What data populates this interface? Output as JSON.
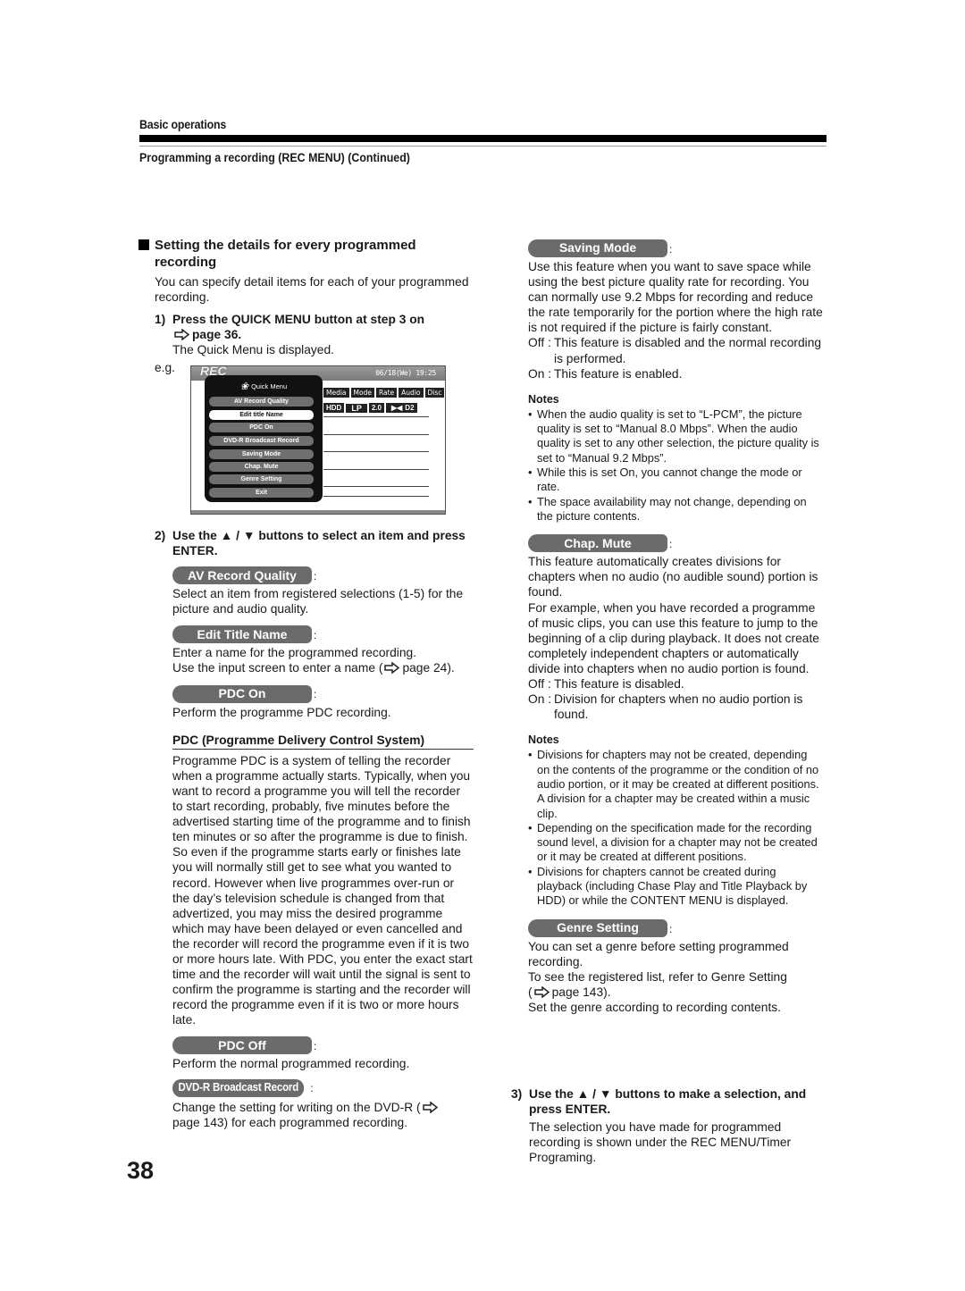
{
  "header": {
    "section": "Basic operations",
    "subsection": "Programming a recording (REC MENU) (Continued)"
  },
  "left": {
    "heading": "Setting the details for every programmed recording",
    "intro": "You can specify detail items for each of your programmed recording.",
    "step1": {
      "num": "1)",
      "text": "Press the QUICK MENU button at step 3 on",
      "ref": "page 36.",
      "result": "The Quick Menu is displayed."
    },
    "eg_label": "e.g.",
    "screen": {
      "rec_label": "REC",
      "datetime": "06/18(We) 19:25",
      "columns": [
        "Media",
        "Mode",
        "Rate",
        "Audio",
        "Disc"
      ],
      "values": [
        "HDD",
        "LP",
        "2.0",
        "D2"
      ],
      "quick_menu": {
        "title": "Quick Menu",
        "items": [
          "AV Record Quality",
          "Edit title Name",
          "PDC On",
          "DVD-R Broadcast Record",
          "Saving Mode",
          "Chap. Mute",
          "Genre Setting",
          "Exit"
        ],
        "selected_index": 1
      }
    },
    "step2": {
      "num": "2)",
      "text": "Use the ▲ / ▼ buttons to select an item and press ENTER."
    },
    "av_record_quality": {
      "label": "AV Record Quality",
      "desc": "Select an item from registered selections (1-5) for the picture and audio quality."
    },
    "edit_title_name": {
      "label": "Edit Title Name",
      "desc1": "Enter a name for the programmed recording.",
      "desc2_pre": "Use the input screen to enter a name (",
      "desc2_ref": "page 24)."
    },
    "pdc_on": {
      "label": "PDC On",
      "desc": "Perform the programme PDC recording."
    },
    "pdc_system": {
      "heading": "PDC (Programme Delivery Control System)",
      "body": "Programme PDC is a system of telling the recorder when a programme actually starts. Typically, when you want to record a programme you will tell the recorder to start recording, probably, five minutes before the advertised starting time of the programme and to finish ten minutes or so after the programme is due to finish. So even if the programme starts early or finishes late you will normally still get to see what you wanted to record. However when live programmes over-run or the day’s television schedule is changed from that advertized, you may miss the desired programme which may have been delayed or even cancelled and the recorder will record the programme even if it is two or more hours late. With PDC, you enter the exact start time and the recorder will wait until the signal is sent to confirm the programme is starting and the recorder will record the programme even if it is two or more hours late."
    },
    "pdc_off": {
      "label": "PDC Off",
      "desc": "Perform the normal programmed recording."
    },
    "dvdr_broadcast": {
      "label": "DVD-R Broadcast Record",
      "desc_pre": "Change the setting for writing on the DVD-R (",
      "desc_post": "page 143) for each programmed recording."
    }
  },
  "right": {
    "saving_mode": {
      "label": "Saving Mode",
      "desc": "Use this feature when you want to save space while using the best picture quality rate for recording. You can normally use 9.2 Mbps for recording and reduce the rate temporarily for the portion where the high rate is not required if the picture is fairly constant.",
      "off_key": "Off :",
      "off_val": "This feature is disabled and the normal recording is performed.",
      "on_key": "On :",
      "on_val": "This feature is enabled.",
      "notes_title": "Notes",
      "notes": [
        "When the audio quality is set to “L-PCM”, the picture quality is set to “Manual 8.0 Mbps”. When the audio quality is set to any other selection, the picture quality is set to “Manual 9.2 Mbps”.",
        "While this is set On, you cannot change the mode or rate.",
        "The space availability may not change, depending on the picture contents."
      ]
    },
    "chap_mute": {
      "label": "Chap. Mute",
      "desc1": "This feature automatically creates divisions for chapters when no audio (no audible sound) portion is found.",
      "desc2": "For example, when you have recorded a programme of music clips, you can use this feature to jump to the beginning of a clip during playback. It does not create completely independent chapters or automatically divide into chapters when no audio portion is found.",
      "off_key": "Off :",
      "off_val": "This feature is disabled.",
      "on_key": "On :",
      "on_val": "Division for chapters when no audio portion is found.",
      "notes_title": "Notes",
      "notes": [
        "Divisions for chapters may not be created, depending on the contents of the programme or the condition of no audio portion, or it may be created at different positions. A division for a chapter may be created within a music clip.",
        "Depending on the specification made for the recording sound level, a division for a chapter may not be created or it may be created at different positions.",
        "Divisions for chapters cannot be created during playback (including Chase Play and Title Playback by HDD) or while the CONTENT MENU is displayed."
      ]
    },
    "genre_setting": {
      "label": "Genre Setting",
      "desc1": "You can set a genre before setting programmed recording.",
      "desc2": "To see the registered list, refer to Genre Setting",
      "desc3_pre": "(",
      "desc3_ref": "page 143).",
      "desc4": "Set the genre according to recording contents."
    },
    "step3": {
      "num": "3)",
      "text": "Use the ▲ / ▼ buttons to make a selection, and press ENTER.",
      "result": "The selection you have made for programmed recording is shown under the REC MENU/Timer Programing."
    }
  },
  "footer": {
    "page_number": "38"
  },
  "colon": ":",
  "bullet": "•"
}
